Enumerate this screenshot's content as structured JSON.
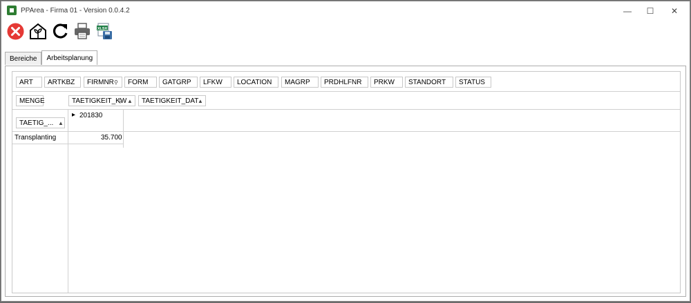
{
  "window": {
    "title": "PPArea - Firma 01 - Version 0.0.4.2",
    "minimize_glyph": "—",
    "maximize_glyph": "☐",
    "close_glyph": "✕"
  },
  "toolbar": {
    "buttons": [
      {
        "name": "close-app-button",
        "icon": "red-x-circle-icon"
      },
      {
        "name": "greenhouse-button",
        "icon": "greenhouse-plant-icon"
      },
      {
        "name": "refresh-button",
        "icon": "refresh-icon"
      },
      {
        "name": "print-button",
        "icon": "printer-icon"
      },
      {
        "name": "export-xlsx-button",
        "icon": "xlsx-save-icon",
        "badge": "XLSX"
      }
    ]
  },
  "tabs": [
    {
      "label": "Bereiche",
      "active": false
    },
    {
      "label": "Arbeitsplanung",
      "active": true
    }
  ],
  "pivot": {
    "filter_fields": [
      "ART",
      "ARTKBZ",
      "FIRMNR",
      "FORM",
      "GATGRP",
      "LFKW",
      "LOCATION",
      "MAGRP",
      "PRDHLFNR",
      "PRKW",
      "STANDORT",
      "STATUS"
    ],
    "data_field": "MENGE",
    "column_fields": [
      "TAETIGKEIT_KW",
      "TAETIGKEIT_DAT"
    ],
    "row_field": "TAETIG_...",
    "column_value": "201830",
    "row_label": "Transplanting",
    "row_value": "35.700",
    "sort_glyph": "▲",
    "filter_glyph": "⚲",
    "expand_glyph": "▸"
  },
  "colors": {
    "accent_green": "#2e7d32",
    "close_red": "#e53935",
    "border": "#c8c8c8"
  }
}
